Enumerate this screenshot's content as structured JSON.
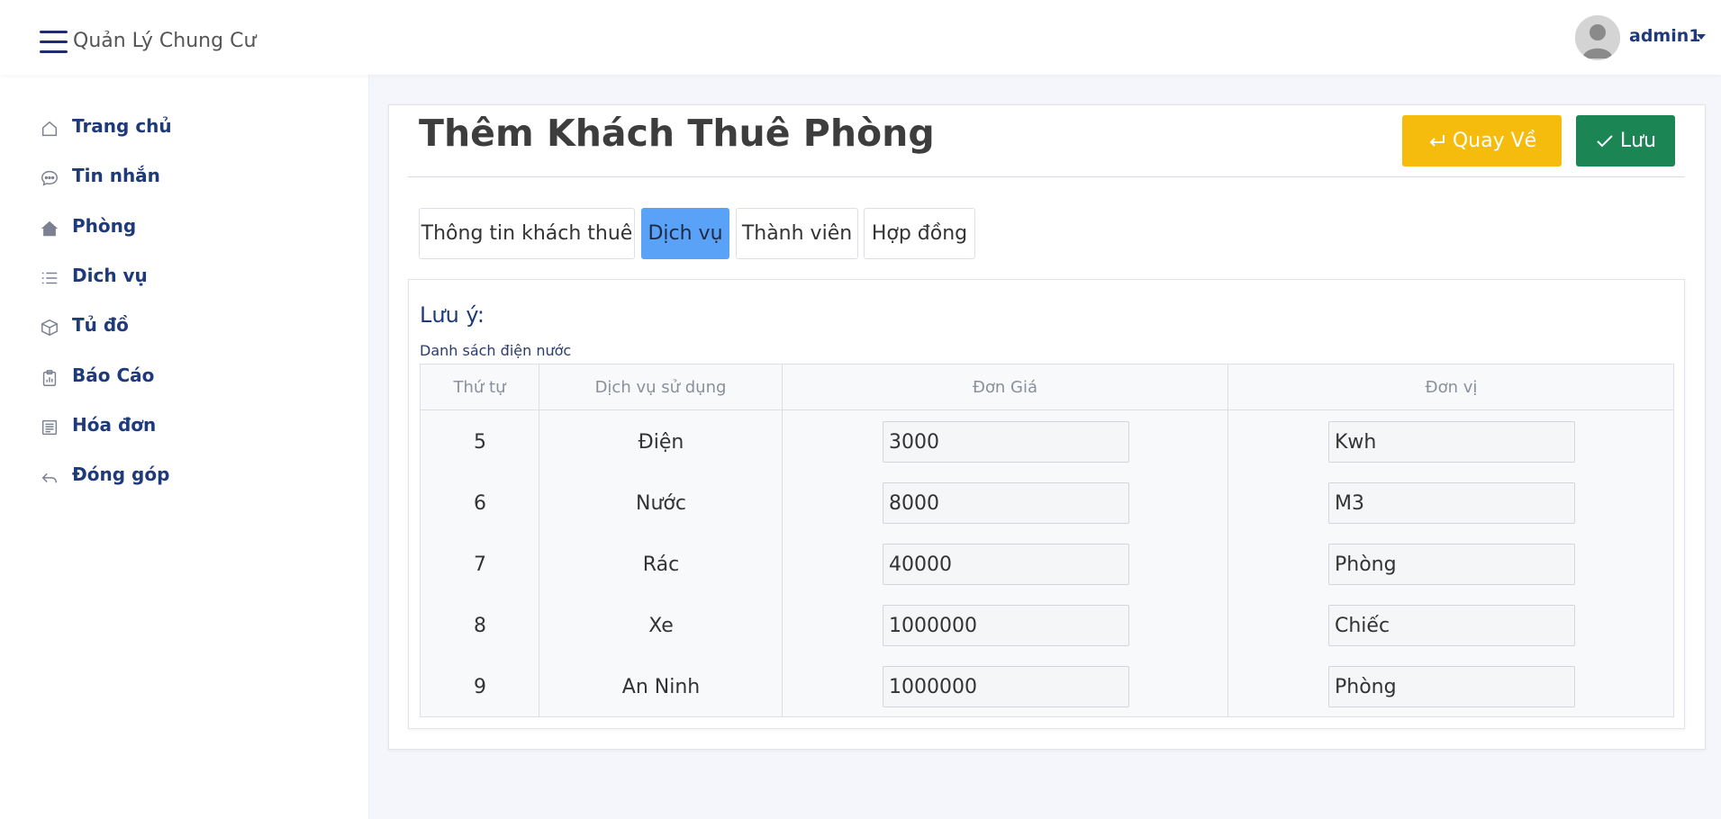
{
  "app": {
    "brand": "Quản Lý Chung Cư",
    "user": "admin1"
  },
  "sidebar": {
    "items": [
      {
        "label": "Trang chủ",
        "icon": "home-icon"
      },
      {
        "label": "Tin nhắn",
        "icon": "chat-icon"
      },
      {
        "label": "Phòng",
        "icon": "house-icon"
      },
      {
        "label": "Dich vụ",
        "icon": "list-icon"
      },
      {
        "label": "Tủ đồ",
        "icon": "box-icon"
      },
      {
        "label": "Báo Cáo",
        "icon": "clipboard-icon"
      },
      {
        "label": "Hóa đơn",
        "icon": "receipt-icon"
      },
      {
        "label": "Đóng góp",
        "icon": "reply-icon"
      }
    ]
  },
  "page": {
    "title": "Thêm Khách Thuê Phòng",
    "back_label": "Quay Về",
    "save_label": "Lưu"
  },
  "tabs": [
    {
      "label": "Thông tin khách thuê",
      "active": false
    },
    {
      "label": "Dịch vụ",
      "active": true
    },
    {
      "label": "Thành viên",
      "active": false
    },
    {
      "label": "Hợp đồng",
      "active": false
    }
  ],
  "services": {
    "note_title": "Lưu ý:",
    "note_subtitle": "Danh sách điện nước",
    "columns": [
      "Thứ tự",
      "Dịch vụ sử dụng",
      "Đơn Giá",
      "Đơn vị"
    ],
    "rows": [
      {
        "order": "5",
        "service": "Điện",
        "price": "3000",
        "unit": "Kwh"
      },
      {
        "order": "6",
        "service": "Nước",
        "price": "8000",
        "unit": "M3"
      },
      {
        "order": "7",
        "service": "Rác",
        "price": "40000",
        "unit": "Phòng"
      },
      {
        "order": "8",
        "service": "Xe",
        "price": "1000000",
        "unit": "Chiếc"
      },
      {
        "order": "9",
        "service": "An Ninh",
        "price": "1000000",
        "unit": "Phòng"
      }
    ]
  },
  "colors": {
    "nav_text": "#1f3a7a",
    "back_button": "#f5bb0d",
    "save_button": "#1c8554",
    "active_tab": "#5aa2f7"
  }
}
